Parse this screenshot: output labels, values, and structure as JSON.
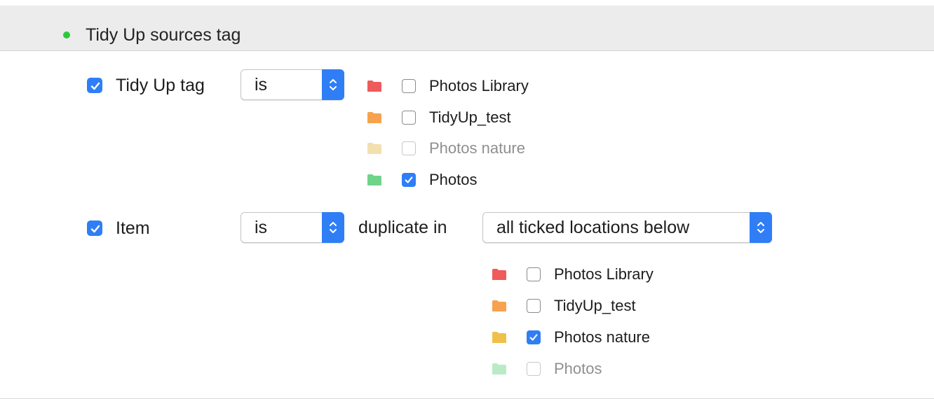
{
  "header": {
    "title": "Tidy Up sources tag",
    "status_color": "#2cc93f"
  },
  "rule1": {
    "checkbox_checked": true,
    "label": "Tidy Up tag",
    "operator": "is",
    "locations": [
      {
        "name": "Photos Library",
        "color": "#f05a5a",
        "checked": false,
        "enabled": true
      },
      {
        "name": "TidyUp_test",
        "color": "#f6a24f",
        "checked": false,
        "enabled": true
      },
      {
        "name": "Photos nature",
        "color": "#f3dfae",
        "checked": false,
        "enabled": false
      },
      {
        "name": "Photos",
        "color": "#6fd38a",
        "checked": true,
        "enabled": true
      }
    ]
  },
  "rule2": {
    "checkbox_checked": true,
    "label": "Item",
    "operator": "is",
    "connector": "duplicate in",
    "scope": "all ticked locations below",
    "locations": [
      {
        "name": "Photos Library",
        "color": "#f05a5a",
        "checked": false,
        "enabled": true
      },
      {
        "name": "TidyUp_test",
        "color": "#f6a24f",
        "checked": false,
        "enabled": true
      },
      {
        "name": "Photos nature",
        "color": "#eec14a",
        "checked": true,
        "enabled": true
      },
      {
        "name": "Photos",
        "color": "#b9ebc6",
        "checked": false,
        "enabled": false
      }
    ]
  }
}
